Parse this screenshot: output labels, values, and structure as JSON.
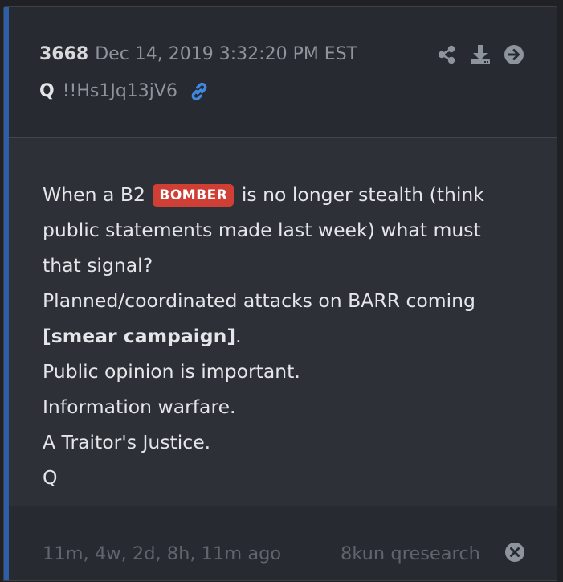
{
  "post": {
    "number": "3668",
    "timestamp": "Dec 14, 2019 3:32:20 PM EST",
    "author": "Q",
    "tripcode": "!!Hs1Jq13jV6",
    "icons": {
      "link": "link-icon",
      "share": "share-icon",
      "download": "download-icon",
      "goto": "arrow-right-circle-icon",
      "close": "close-circle-icon"
    },
    "body": {
      "line1_pre": "When a B2",
      "tag": "BOMBER",
      "line1_post": "is no longer stealth (think",
      "line2": "public statements made last week) what must",
      "line3": "that signal?",
      "line4": "Planned/coordinated attacks on BARR coming",
      "line5_bold": "[smear campaign]",
      "line5_post": ".",
      "line6": "Public opinion is important.",
      "line7": "Information warfare.",
      "line8": "A Traitor's Justice.",
      "line9": "Q"
    },
    "footer": {
      "age": "11m, 4w, 2d, 8h, 11m ago",
      "source": "8kun qresearch"
    }
  },
  "colors": {
    "accent_bar": "#2e5ea8",
    "link_icon": "#3f8ae0",
    "tag_background": "#cf3f36"
  }
}
